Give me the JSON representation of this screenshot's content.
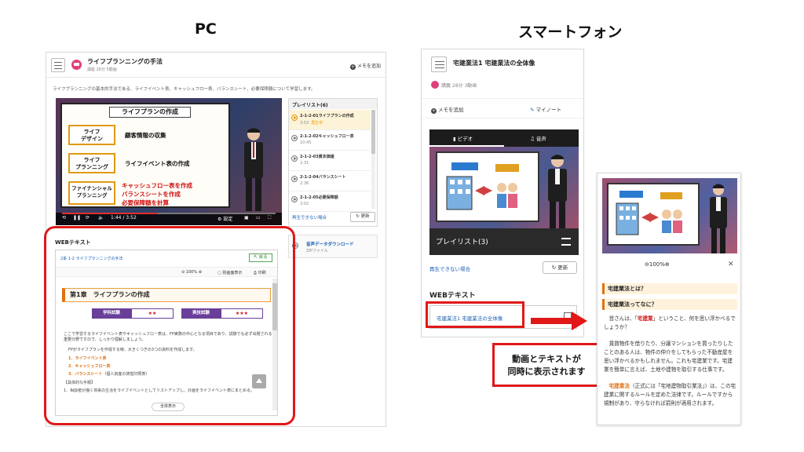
{
  "headings": {
    "pc": "PC",
    "smartphone": "スマートフォン"
  },
  "pc": {
    "title": "ライフプランニングの手法",
    "meta": "講座 26分 5動画",
    "memo_add": "メモを追加",
    "description": "ライフプランニングの基本的手法である、ライフイベント表、キャッシュフロー表、バランスシート、必要保障額について学習します。",
    "video": {
      "slide_title": "ライフプランの作成",
      "boxes": [
        "ライフ\nデザイン",
        "ライフ\nプランニング",
        "ファイナンシャル\nプランニング"
      ],
      "labels": [
        "顧客情報の収集",
        "ライフイベント表の作成"
      ],
      "red_lines": [
        "キャッシュフロー表を作成",
        "バランスシートを作成",
        "必要保障額を計算"
      ],
      "time": "1:44 / 3:52",
      "settings": "設定",
      "progress": 0.45
    },
    "playlist": {
      "header": "プレイリスト(6)",
      "items": [
        {
          "name": "2-1-2-01ライフプランの作成",
          "time": "3:53",
          "now": "再生中"
        },
        {
          "name": "2-1-2-02キャッシュフロー表",
          "time": "10:45",
          "now": ""
        },
        {
          "name": "2-1-2-03資本価値",
          "time": "2:31",
          "now": ""
        },
        {
          "name": "2-1-2-04バランスシート",
          "time": "2:36",
          "now": ""
        },
        {
          "name": "2-1-2-05必要保障額",
          "time": "3:02",
          "now": ""
        }
      ],
      "cannot_play": "再生できない場合",
      "refresh": "更新"
    },
    "audio": {
      "label": "音声データダウンロード",
      "sub": "ZIPファイル"
    },
    "webtext": {
      "label": "WEBテキスト",
      "crumb": "2系 1-2 ライフプランニングの手法",
      "return": "戻る",
      "zoom": "100%",
      "contrast": "別画面表示",
      "print": "印刷",
      "chapter": "第1章　ライフプランの作成",
      "diff": [
        {
          "label": "学科試験",
          "value": "★★"
        },
        {
          "label": "実技試験",
          "value": "★★★"
        }
      ],
      "body1": "ここで学習するライフイベント表やキャッシュフロー表は、FP実務の中心となる項目であり、試験でも必ず出題される重要分野ですので、しっかり理解しましょう。",
      "body2": "FPがライフプランを作成する時、大きくつぎの3つの資料を作成します。",
      "list": [
        "1．ライフイベント表",
        "2．キャッシュフロー表",
        "3．バランスシート"
      ],
      "list3_note": "（個人資産の貸借対照表）",
      "body3": "【具体的な手順】",
      "body4": "1．相談者が描く将来の生活をライフイベントとしてリストアップし、計画をライフイベント表にまとめる。",
      "full": "全体表示"
    }
  },
  "sp": {
    "title": "宅建業法1 宅建業法の全体像",
    "meta": "講義 28分 3動画",
    "memo_add": "メモを追加",
    "mynote": "マイノート",
    "tab_video": "ビデオ",
    "tab_audio": "音声",
    "playlist": "プレイリスト(3)",
    "cannot_play": "再生できない場合",
    "refresh": "更新",
    "web_label": "WEBテキスト",
    "web_link": "宅建業法1 宅建業法の全体像"
  },
  "callout": {
    "line1": "動画とテキストが",
    "line2": "同時に表示されます"
  },
  "text_panel": {
    "zoom": "100%",
    "sec1": "宅建業法とは？",
    "sec2": "宅建業法ってなに？",
    "p1_a": "皆さんは、「",
    "p1_red": "宅建業",
    "p1_b": "」ということ、何を思い浮かべるでしょうか？",
    "p2": "賃貸物件を借りたり、分譲マンションを買ったりしたことのある人は、物件の仲介をしてもらった不動産屋を思い浮かべるかもしれません。これも宅建業です。宅建業を簡単に言えば、土地や建物を取引する仕事です。",
    "p3_org": "宅建業法",
    "p3_b": "（正式には「宅地建物取引業法」）は、この宅建業に関するルールを定めた法律です。ルールですから規制があり、守らなければ罰則が適用されます。"
  }
}
